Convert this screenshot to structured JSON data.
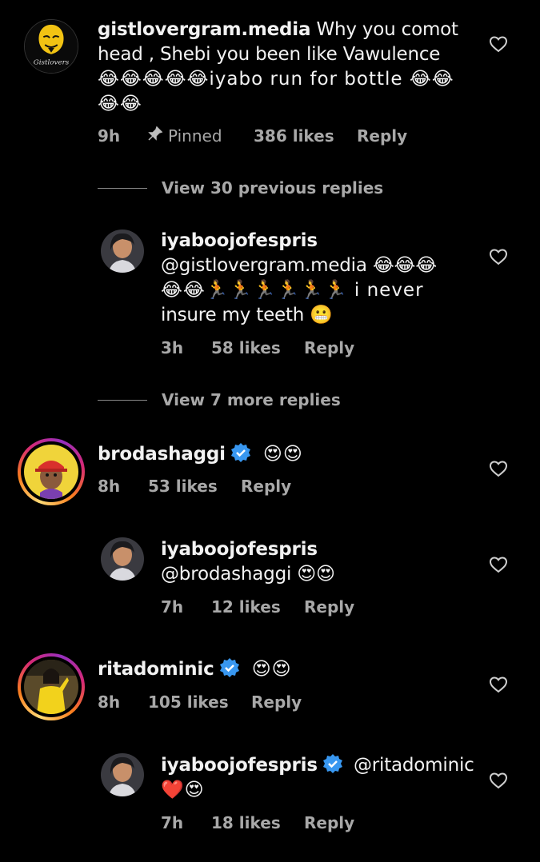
{
  "comments": [
    {
      "username": "gistlovergram.media",
      "text_line1": " Why you comot",
      "text_line2": "head , Shebi you been like Vawulence",
      "text_line3": "😂😂😂😂😂iyabo run for bottle 😂😂",
      "text_line4": "😂😂",
      "time": "9h",
      "pinned": "Pinned",
      "likes": "386 likes",
      "reply": "Reply",
      "avatar_text": "Gistlovers"
    },
    {
      "username": "iyaboojofespris",
      "text_line1": "@gistlovergram.media 😂😂😂",
      "text_line2": "😂😂🏃🏃🏃🏃🏃🏃 i never",
      "text_line3": "insure my teeth 😬",
      "time": "3h",
      "likes": "58 likes",
      "reply": "Reply"
    },
    {
      "username": "brodashaggi",
      "emojis": "😍😍",
      "time": "8h",
      "likes": "53 likes",
      "reply": "Reply"
    },
    {
      "username": "iyaboojofespris",
      "text_line1": "@brodashaggi 😍😍",
      "time": "7h",
      "likes": "12 likes",
      "reply": "Reply"
    },
    {
      "username": "ritadominic",
      "emojis": "😍😍",
      "time": "8h",
      "likes": "105 likes",
      "reply": "Reply"
    },
    {
      "username": "iyaboojofespris",
      "mention": "@ritadominic",
      "text_line2": "❤️😍",
      "time": "7h",
      "likes": "18 likes",
      "reply": "Reply"
    }
  ],
  "view_previous": "View 30 previous replies",
  "view_more": "View 7 more replies",
  "colors": {
    "background": "#000000",
    "text": "#f2f2f2",
    "meta": "#a8a8a8",
    "verified": "#3897f0"
  }
}
